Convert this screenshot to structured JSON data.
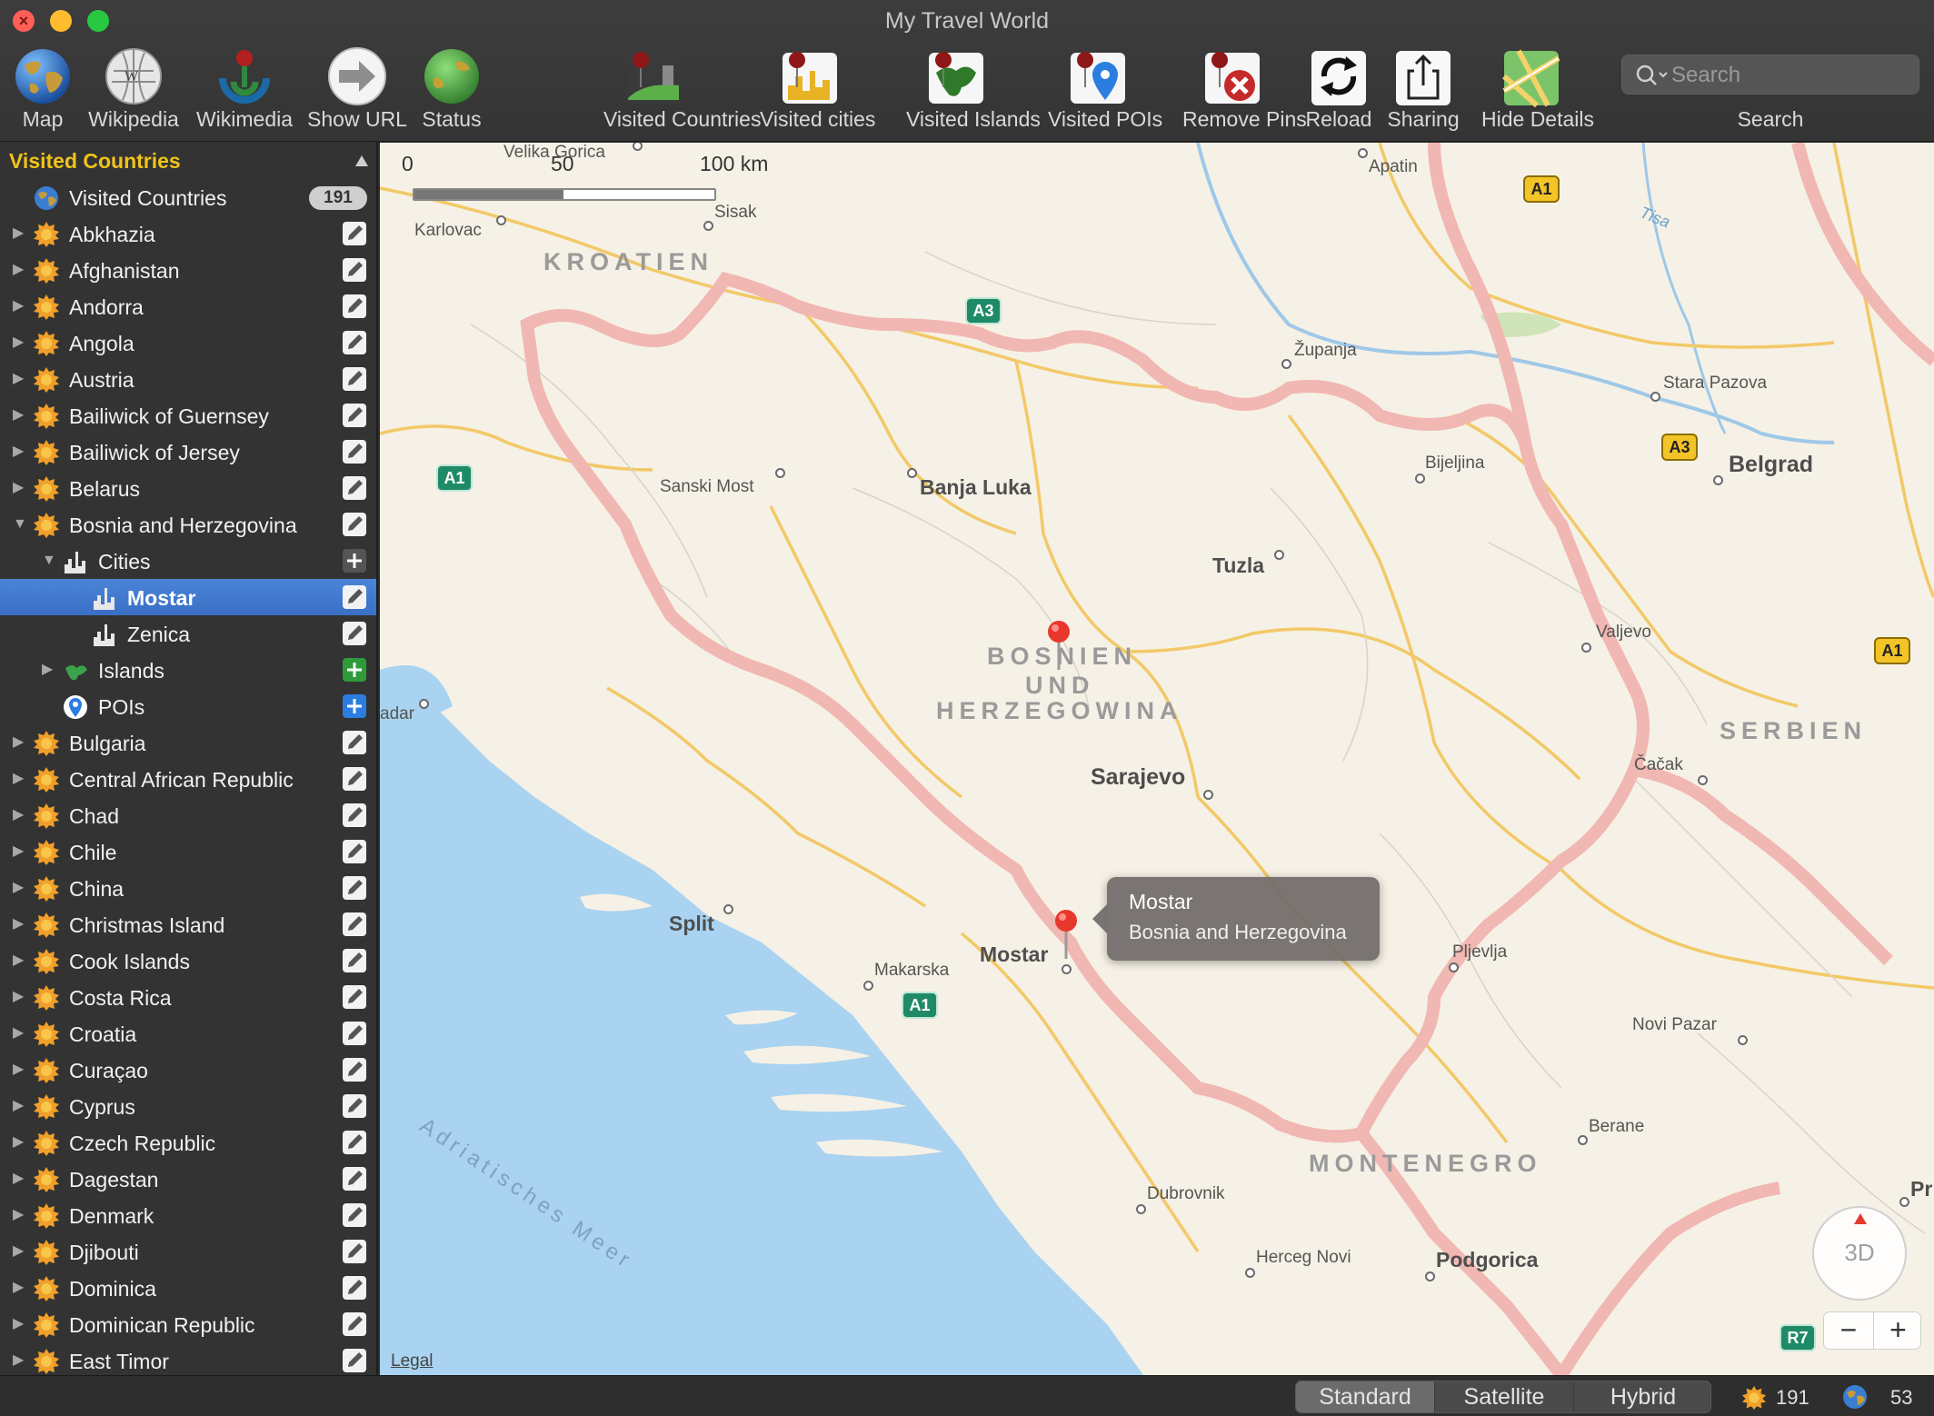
{
  "window": {
    "title": "My Travel World"
  },
  "toolbar": {
    "map": "Map",
    "wikipedia": "Wikipedia",
    "wikimedia": "Wikimedia",
    "show_url": "Show URL",
    "status": "Status",
    "visited_countries": "Visited Countries",
    "visited_cities": "Visited cities",
    "visited_islands": "Visited Islands",
    "visited_pois": "Visited POIs",
    "remove_pins": "Remove Pins",
    "reload": "Reload",
    "sharing": "Sharing",
    "hide_details": "Hide Details",
    "search_placeholder": "Search",
    "search_label": "Search"
  },
  "sidebar": {
    "title": "Visited Countries",
    "root": {
      "label": "Visited Countries",
      "count": "191"
    },
    "countries_before": [
      "Abkhazia",
      "Afghanistan",
      "Andorra",
      "Angola",
      "Austria",
      "Bailiwick of Guernsey",
      "Bailiwick of Jersey",
      "Belarus"
    ],
    "expanded": {
      "label": "Bosnia and Herzegovina",
      "cities_label": "Cities",
      "cities": [
        "Mostar",
        "Zenica"
      ],
      "islands_label": "Islands",
      "pois_label": "POIs"
    },
    "countries_after": [
      "Bulgaria",
      "Central African Republic",
      "Chad",
      "Chile",
      "China",
      "Christmas Island",
      "Cook Islands",
      "Costa Rica",
      "Croatia",
      "Curaçao",
      "Cyprus",
      "Czech Republic",
      "Dagestan",
      "Denmark",
      "Djibouti",
      "Dominica",
      "Dominican Republic",
      "East Timor"
    ]
  },
  "map": {
    "scale": {
      "zero": "0",
      "fifty": "50",
      "hundred": "100 km"
    },
    "countries": {
      "kroatien": "KROATIEN",
      "bosnien1": "BOSNIEN",
      "bosnien2": "UND",
      "bosnien3": "HERZEGOWINA",
      "serbien": "SERBIEN",
      "montenegro": "MONTENEGRO"
    },
    "sea": "Adriatisches Meer",
    "river_tisa": "Tisa",
    "cities": {
      "velika_gorica": "Velika Gorica",
      "karlovac": "Karlovac",
      "sisak": "Sisak",
      "apatin": "Apatin",
      "zupanja": "Županja",
      "stara_pazova": "Stara Pazova",
      "belgrad": "Belgrad",
      "bijeljina": "Bijeljina",
      "sanski_most": "Sanski Most",
      "banja_luka": "Banja Luka",
      "tuzla": "Tuzla",
      "valjevo": "Valjevo",
      "zadar": "adar",
      "sarajevo": "Sarajevo",
      "cacak": "Čačak",
      "split": "Split",
      "makarska": "Makarska",
      "mostar": "Mostar",
      "pljevlja": "Pljevlja",
      "novi_pazar": "Novi Pazar",
      "berane": "Berane",
      "dubrovnik": "Dubrovnik",
      "herceg_novi": "Herceg Novi",
      "podgorica": "Podgorica",
      "pr": "Pr"
    },
    "shields": {
      "a1_west": "A1",
      "a3_north": "A3",
      "a1_ne": "A1",
      "a3_east": "A3",
      "a1_east": "A1",
      "a1_south": "A1",
      "r7": "R7"
    },
    "callout": {
      "title": "Mostar",
      "subtitle": "Bosnia and Herzegovina"
    },
    "legal": "Legal",
    "compass": "3D",
    "zoom_out": "−",
    "zoom_in": "+"
  },
  "bottom": {
    "standard": "Standard",
    "satellite": "Satellite",
    "hybrid": "Hybrid",
    "countries_count": "191",
    "visited_count": "53"
  }
}
